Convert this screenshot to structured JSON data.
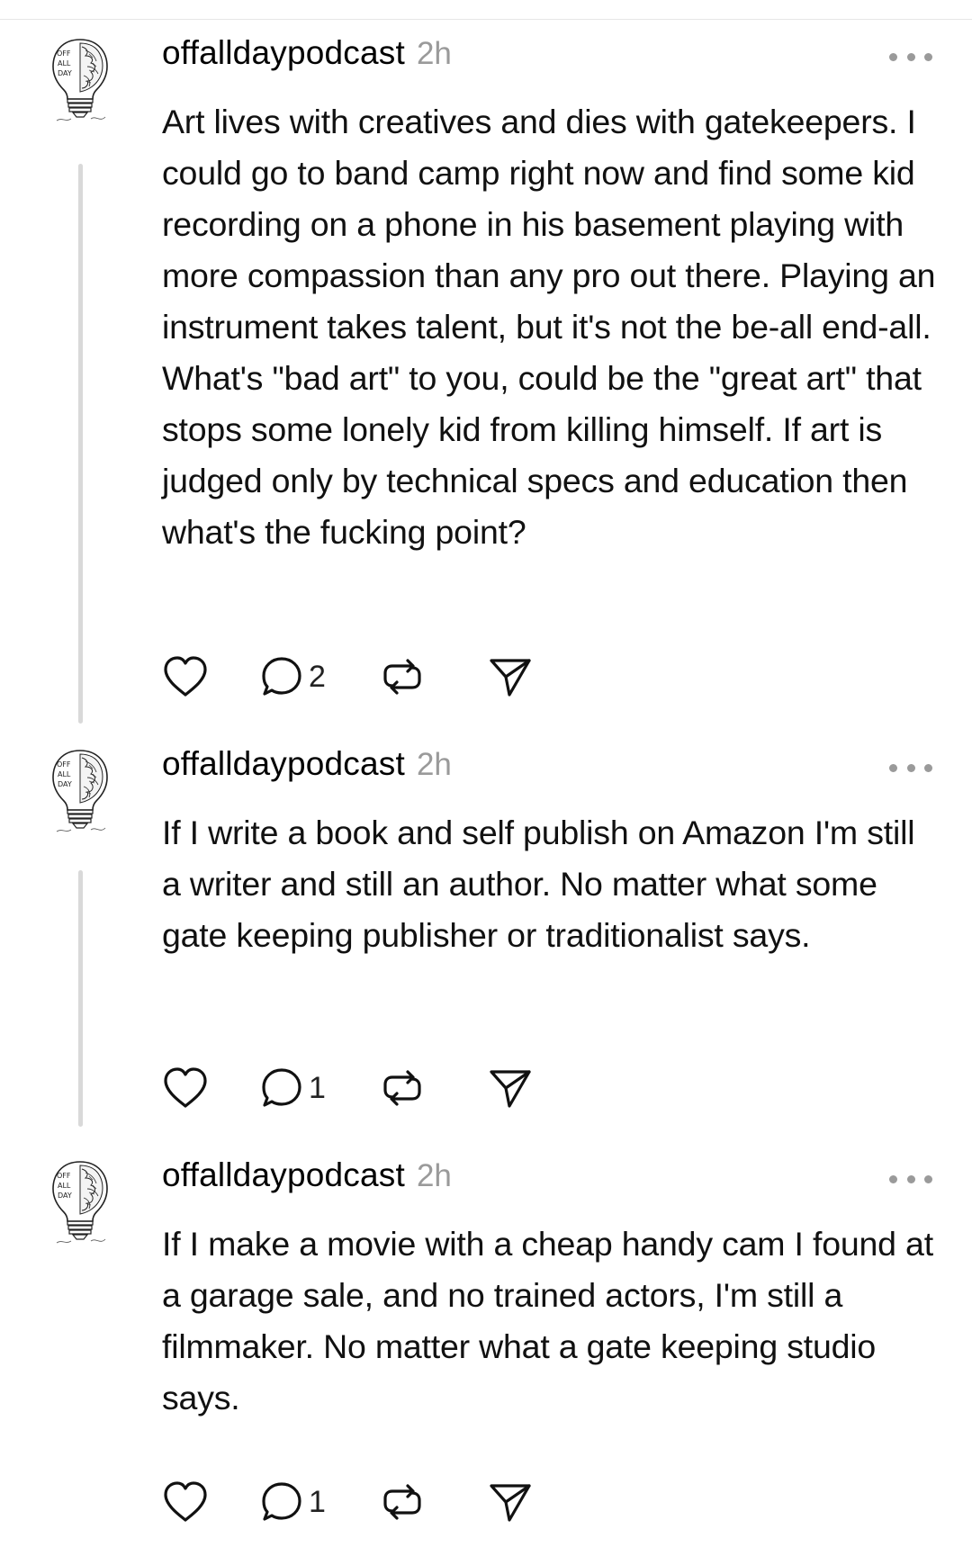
{
  "posts": [
    {
      "username": "offalldaypodcast",
      "time": "2h",
      "text": "Art lives with creatives and dies with gatekeepers. I could go to band camp right now and find some kid recording on a phone in his basement playing with more compassion than any pro out there. Playing an instrument takes talent, but it's not the be-all end-all. What's \"bad art\" to you, could be the \"great art\" that stops some lonely kid from killing himself. If art is judged only by technical specs and education then what's the fucking point?",
      "reply_count": "2",
      "avatar_icon": "off-all-day-lightbulb-brain-logo"
    },
    {
      "username": "offalldaypodcast",
      "time": "2h",
      "text": "If I write a book and self publish on Amazon I'm still a writer and still an author. No matter what some gate keeping publisher or traditionalist says.",
      "reply_count": "1",
      "avatar_icon": "off-all-day-lightbulb-brain-logo"
    },
    {
      "username": "offalldaypodcast",
      "time": "2h",
      "text": "If I make a movie with a cheap handy cam I found at a garage sale, and no trained actors, I'm still a filmmaker. No matter what a gate keeping studio says.",
      "reply_count": "1",
      "avatar_icon": "off-all-day-lightbulb-brain-logo"
    }
  ],
  "icons": {
    "like": "heart-icon",
    "reply": "reply-icon",
    "repost": "repost-icon",
    "share": "share-icon",
    "more": "more-icon"
  },
  "colors": {
    "text": "#111111",
    "secondary": "#9a9a9a",
    "thread_line": "#d9d9d9",
    "background": "#ffffff"
  }
}
